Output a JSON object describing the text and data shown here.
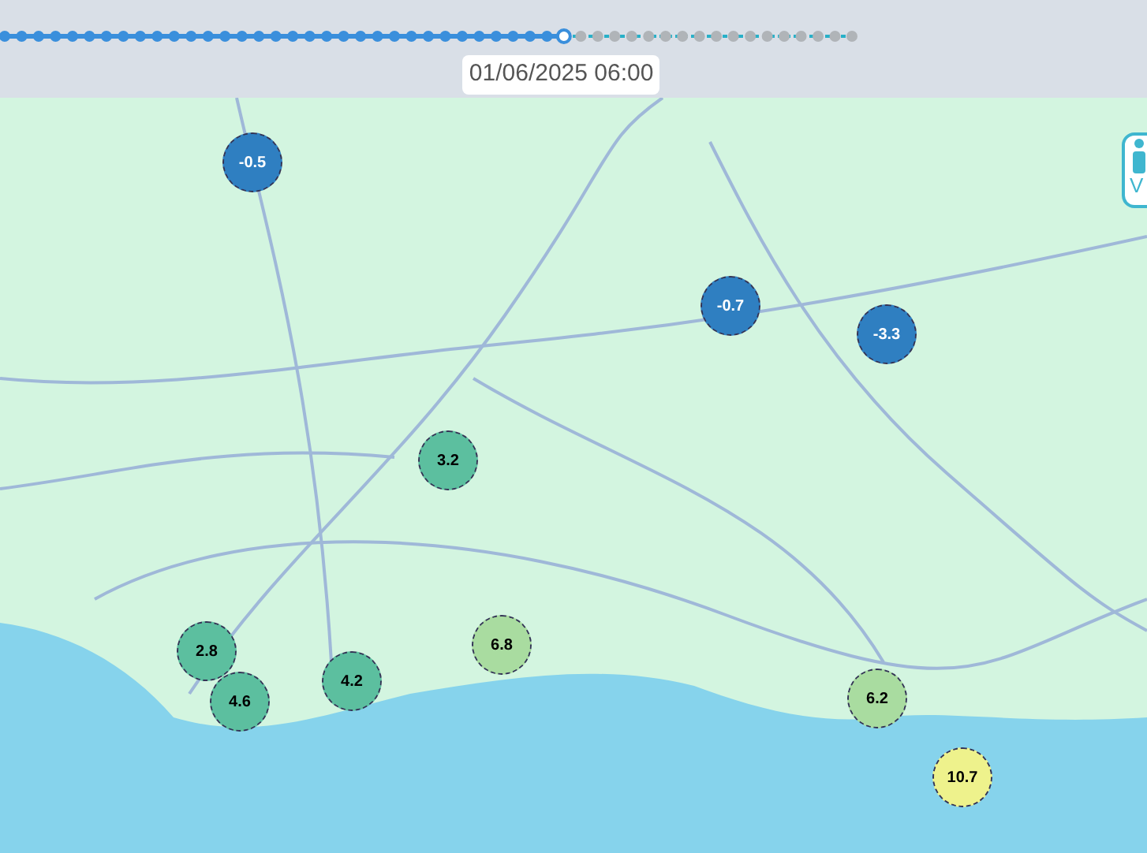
{
  "timeline": {
    "level": 0.66,
    "label": "01/06/2025 06:00"
  },
  "markers": [
    {
      "value": "-0.5",
      "color": "#2f7fc1"
    },
    {
      "value": "-0.7",
      "color": "#2f7fc1"
    },
    {
      "value": "-3.3",
      "color": "#2f7fc1"
    },
    {
      "value": "3.2",
      "color": "#5cbf9f"
    },
    {
      "value": "2.8",
      "color": "#5cbf9f"
    },
    {
      "value": "4.6",
      "color": "#5cbf9f"
    },
    {
      "value": "4.2",
      "color": "#5cbf9f"
    },
    {
      "value": "6.8",
      "color": "#a9dca0"
    },
    {
      "value": "6.2",
      "color": "#a9dca0"
    },
    {
      "value": "10.7",
      "color": "#eef28c"
    }
  ],
  "side_button": {
    "label": "V"
  }
}
